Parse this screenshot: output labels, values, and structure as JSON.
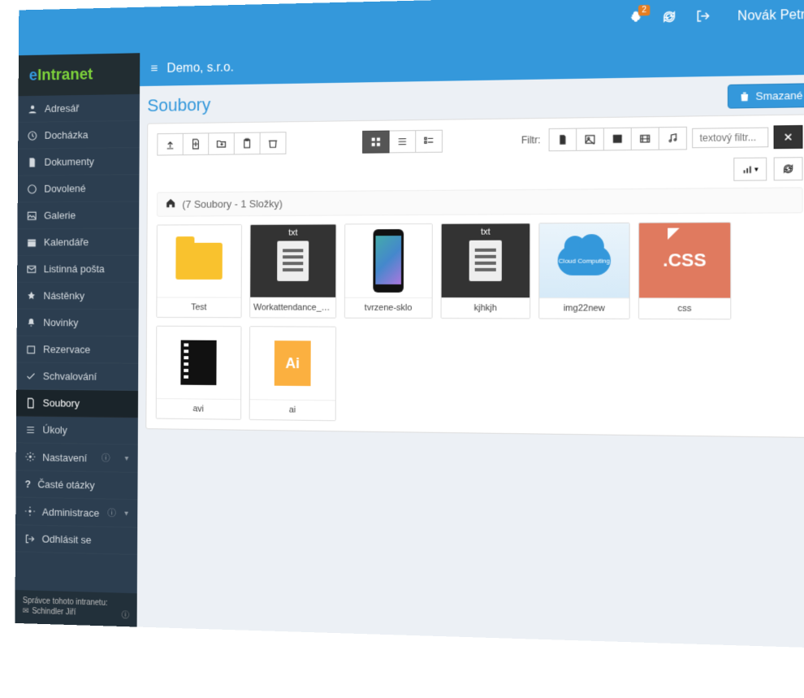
{
  "topbar": {
    "notif_count": "2",
    "username": "Novák Petr"
  },
  "logo": {
    "e": "e",
    "rest": "Intranet"
  },
  "sidebar": {
    "items": [
      {
        "label": "Adresář"
      },
      {
        "label": "Docházka"
      },
      {
        "label": "Dokumenty"
      },
      {
        "label": "Dovolené"
      },
      {
        "label": "Galerie"
      },
      {
        "label": "Kalendáře"
      },
      {
        "label": "Listinná pošta"
      },
      {
        "label": "Nástěnky"
      },
      {
        "label": "Novinky"
      },
      {
        "label": "Rezervace"
      },
      {
        "label": "Schvalování"
      },
      {
        "label": "Soubory"
      },
      {
        "label": "Úkoly"
      },
      {
        "label": "Nastavení"
      },
      {
        "label": "Časté otázky"
      },
      {
        "label": "Administrace"
      },
      {
        "label": "Odhlásit se"
      }
    ],
    "footer": {
      "title": "Správce tohoto intranetu:",
      "name": "Schindler Jiří"
    }
  },
  "breadcrumb": {
    "company": "Demo, s.r.o."
  },
  "page": {
    "title": "Soubory",
    "deleted_btn": "Smazané",
    "filter_label": "Filtr:",
    "filter_placeholder": "textový filtr...",
    "path_info": "(7 Soubory - 1 Složky)"
  },
  "files": [
    {
      "name": "Test"
    },
    {
      "name": "Workattendance_d..."
    },
    {
      "name": "tvrzene-sklo"
    },
    {
      "name": "kjhkjh"
    },
    {
      "name": "img22new"
    },
    {
      "name": "css"
    },
    {
      "name": "avi"
    },
    {
      "name": "ai"
    }
  ],
  "thumb_text": {
    "txt": "txt",
    "css": ".CSS",
    "ai": "Ai",
    "cloud": "Cloud Computing"
  }
}
